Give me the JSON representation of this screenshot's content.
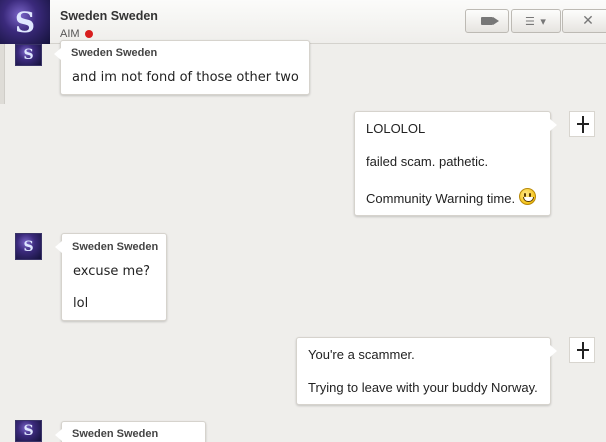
{
  "header": {
    "contact_name": "Sweden Sweden",
    "service": "AIM",
    "status_color": "#d81e1e",
    "buttons": {
      "video_icon": "video-camera-icon",
      "menu_icon": "list-menu-icon",
      "close_label": "✕"
    }
  },
  "messages": [
    {
      "direction": "in",
      "sender": "Sweden Sweden",
      "lines": [
        "and im not fond of those other two"
      ]
    },
    {
      "direction": "out",
      "lines": [
        "LOLOLOL",
        "failed scam. pathetic.",
        "Community Warning time."
      ],
      "emoji": "smiley-emoji-icon"
    },
    {
      "direction": "in",
      "sender": "Sweden Sweden",
      "lines": [
        "excuse me?",
        "lol"
      ]
    },
    {
      "direction": "out",
      "lines": [
        "You're a scammer.",
        "Trying to leave with your buddy Norway."
      ]
    },
    {
      "direction": "in",
      "sender": "Sweden Sweden",
      "lines": []
    }
  ]
}
